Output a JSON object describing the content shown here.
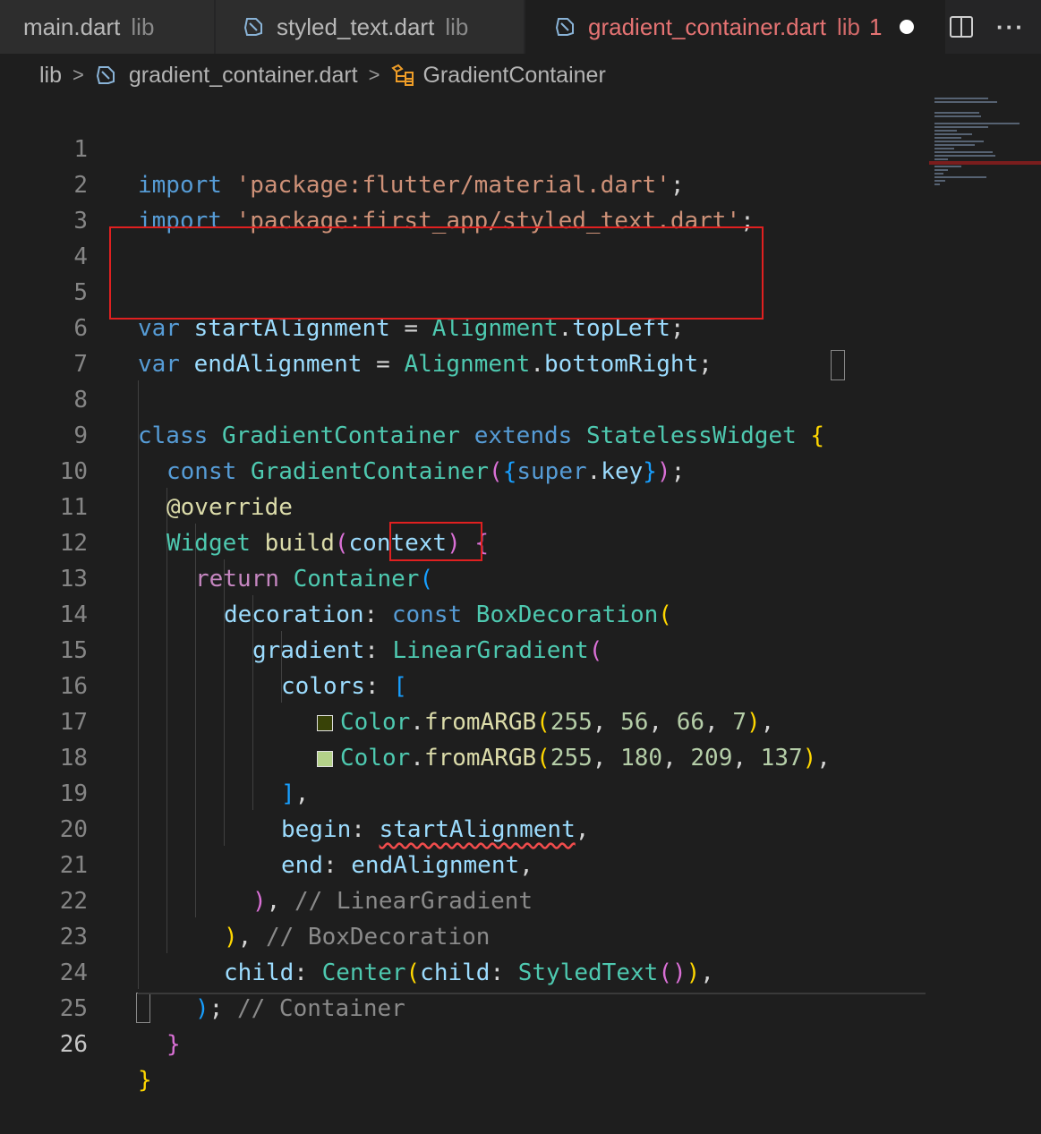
{
  "tabs": [
    {
      "name": "main.dart",
      "dir": "lib",
      "active": false
    },
    {
      "name": "styled_text.dart",
      "dir": "lib",
      "active": false
    },
    {
      "name": "gradient_container.dart",
      "dir": "lib",
      "errors": "1",
      "active": true,
      "dirty": true
    }
  ],
  "tab_actions": {
    "split_icon": "split-editor-icon",
    "more_label": "···"
  },
  "breadcrumb": {
    "folder": "lib",
    "file": "gradient_container.dart",
    "symbol": "GradientContainer"
  },
  "colors": {
    "swatch_dark": "#384207",
    "swatch_light": "#b4d189",
    "highlight_box": "#e02020"
  },
  "line_numbers": [
    "1",
    "2",
    "3",
    "4",
    "5",
    "6",
    "7",
    "8",
    "9",
    "10",
    "11",
    "12",
    "13",
    "14",
    "15",
    "16",
    "17",
    "18",
    "19",
    "20",
    "21",
    "22",
    "23",
    "24",
    "25",
    "26"
  ],
  "code": {
    "l1": {
      "kw": "import",
      "str": "'package:flutter/material.dart'",
      "end": ";"
    },
    "l2": {
      "kw": "import",
      "str": "'package:first_app/styled_text.dart'",
      "end": ";"
    },
    "l5": {
      "kw": "var",
      "name": "startAlignment",
      "eq": " = ",
      "cls": "Alignment",
      "dot": ".",
      "prop": "topLeft",
      "end": ";"
    },
    "l6": {
      "kw": "var",
      "name": "endAlignment",
      "eq": " = ",
      "cls": "Alignment",
      "dot": ".",
      "prop": "bottomRight",
      "end": ";"
    },
    "l8": {
      "kw1": "class",
      "name": "GradientContainer",
      "kw2": "extends",
      "base": "StatelessWidget",
      "brace": "{"
    },
    "l9": {
      "kw": "const",
      "name": "GradientContainer",
      "p1": "(",
      "p2": "{",
      "sup": "super",
      "dot": ".",
      "key": "key",
      "p3": "}",
      "p4": ")",
      "end": ";"
    },
    "l10": {
      "anno": "@override"
    },
    "l11": {
      "ty": "Widget",
      "fn": "build",
      "p1": "(",
      "arg": "context",
      "p2": ")",
      "brace": "{"
    },
    "l12": {
      "kw": "return",
      "ty": "Container",
      "p": "("
    },
    "l13": {
      "prop": "decoration",
      "colon": ": ",
      "kw": "const",
      "ty": "BoxDecoration",
      "p": "("
    },
    "l14": {
      "prop": "gradient",
      "colon": ": ",
      "ty": "LinearGradient",
      "p": "("
    },
    "l15": {
      "prop": "colors",
      "colon": ": ",
      "b": "["
    },
    "l16": {
      "ty": "Color",
      "dot": ".",
      "fn": "fromARGB",
      "p1": "(",
      "a": "255",
      "r": "56",
      "g": "66",
      "bl": "7",
      "p2": ")",
      "end": ","
    },
    "l17": {
      "ty": "Color",
      "dot": ".",
      "fn": "fromARGB",
      "p1": "(",
      "a": "255",
      "r": "180",
      "g": "209",
      "bl": "137",
      "p2": ")",
      "end": ","
    },
    "l18": {
      "b": "]",
      "end": ","
    },
    "l19": {
      "prop": "begin",
      "colon": ": ",
      "val": "startAlignment",
      "end": ","
    },
    "l20": {
      "prop": "end",
      "colon": ": ",
      "val": "endAlignment",
      "end": ","
    },
    "l21": {
      "p": ")",
      "end": ",",
      "cmt": "// LinearGradient"
    },
    "l22": {
      "p": ")",
      "end": ",",
      "cmt": "// BoxDecoration"
    },
    "l23": {
      "prop": "child",
      "colon": ": ",
      "ty": "Center",
      "p1": "(",
      "prop2": "child",
      "colon2": ": ",
      "ty2": "StyledText",
      "p2": "()",
      "p3": ")",
      "end": ","
    },
    "l24": {
      "p": ")",
      "end": ";",
      "cmt": "// Container"
    },
    "l25": {
      "b": "}"
    },
    "l26": {
      "b": "}"
    }
  }
}
